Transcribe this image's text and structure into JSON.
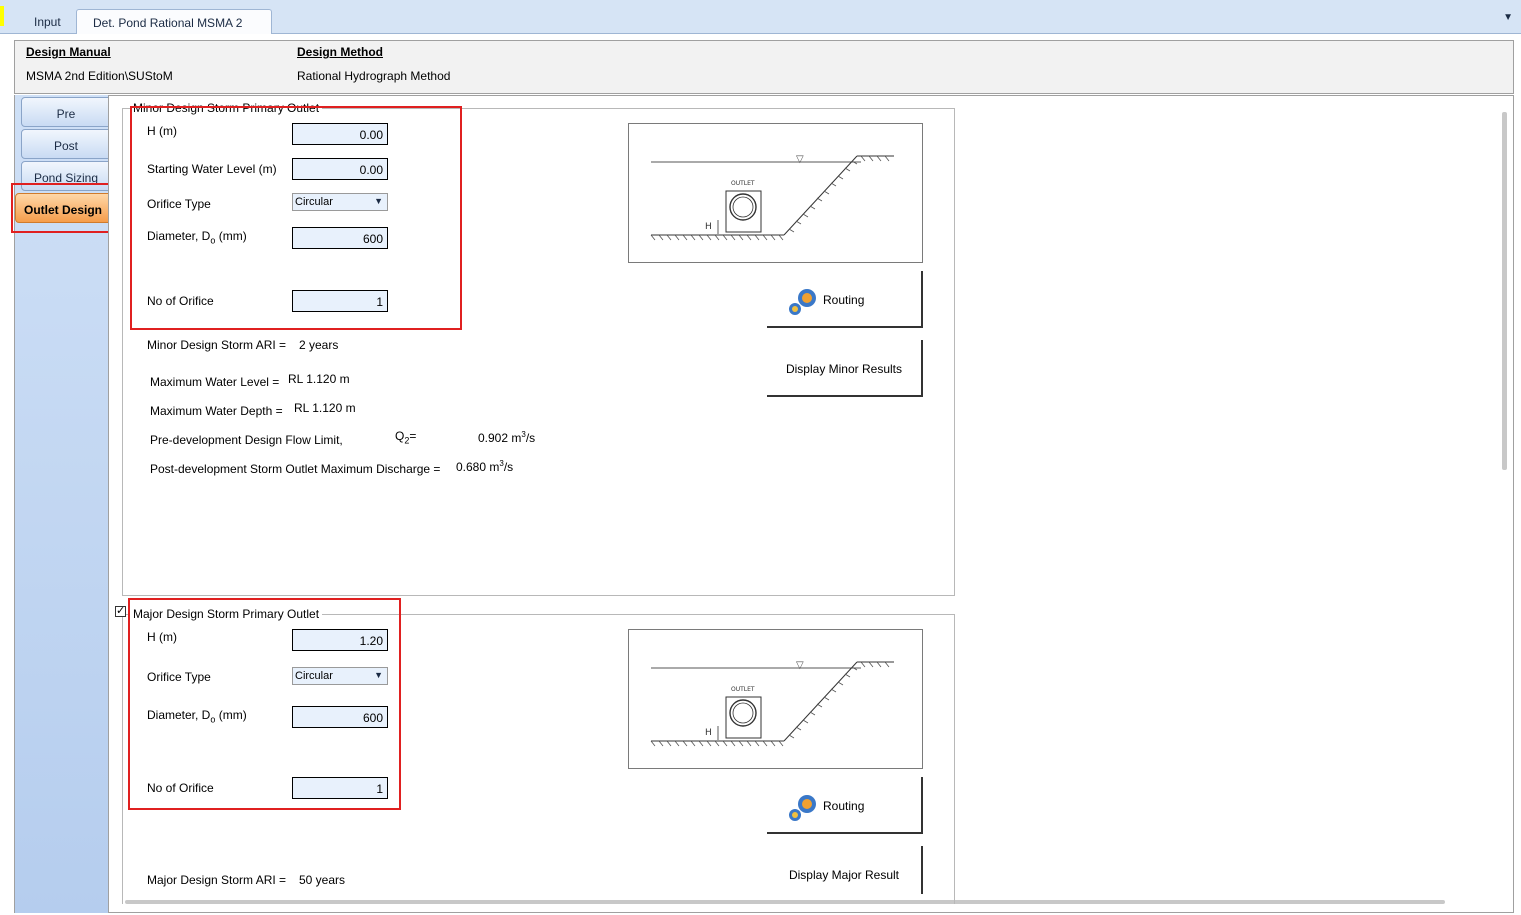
{
  "tabs": {
    "input_label": "Input",
    "active_label": "Det. Pond Rational MSMA 2",
    "dropdown_glyph": "▼"
  },
  "design": {
    "manual_heading": "Design Manual",
    "manual_value": "MSMA 2nd Edition\\SUStoM",
    "method_heading": "Design Method",
    "method_value": "Rational Hydrograph Method"
  },
  "side_tabs": [
    "Pre",
    "Post",
    "Pond Sizing",
    "Outlet Design"
  ],
  "minor": {
    "group_title": "Minor Design Storm Primary Outlet",
    "h_label": "H (m)",
    "h_value": "0.00",
    "swl_label": "Starting Water Level (m)",
    "swl_value": "0.00",
    "orifice_type_label": "Orifice Type",
    "orifice_type_value": "Circular",
    "diameter_label": "Diameter, D",
    "diameter_sub": "o",
    "diameter_unit": " (mm)",
    "diameter_value": "600",
    "no_orifice_label": "No of Orifice",
    "no_orifice_value": "1",
    "ari_label": "Minor Design Storm ARI =",
    "ari_value": "2 years",
    "max_wl_label": "Maximum Water Level =",
    "max_wl_value": "RL 1.120 m",
    "max_wd_label": "Maximum Water Depth =",
    "max_wd_value": "RL 1.120 m",
    "predev_label": "Pre-development Design Flow Limit,",
    "q_sym": "Q",
    "q_sub": "2",
    "q_eq": "=",
    "predev_value": "0.902 m",
    "predev_sup": "3",
    "predev_unit": "/s",
    "postdev_label": "Post-development Storm Outlet Maximum Discharge =",
    "postdev_value": "0.680 m",
    "postdev_sup": "3",
    "postdev_unit": "/s",
    "routing_label": "Routing",
    "display_label": "Display Minor Results"
  },
  "major": {
    "group_title": "Major Design Storm Primary Outlet",
    "checked_glyph": "✓",
    "h_label": "H (m)",
    "h_value": "1.20",
    "orifice_type_label": "Orifice Type",
    "orifice_type_value": "Circular",
    "diameter_label": "Diameter, D",
    "diameter_sub": "o",
    "diameter_unit": " (mm)",
    "diameter_value": "600",
    "no_orifice_label": "No of Orifice",
    "no_orifice_value": "1",
    "ari_label": "Major Design Storm ARI =",
    "ari_value": "50 years",
    "routing_label": "Routing",
    "display_label": "Display Major Result"
  },
  "diagram": {
    "outlet_label": "OUTLET",
    "h_label": "H",
    "water_symbol": "▽"
  },
  "icons": {
    "gear": "gear-icon",
    "dropdown": "chevron-down-icon",
    "tab_menu": "tab-dropdown-icon"
  },
  "colors": {
    "highlight_red": "#e02020",
    "active_tab": "#f59d4b",
    "input_bg": "#e8f1fc"
  }
}
